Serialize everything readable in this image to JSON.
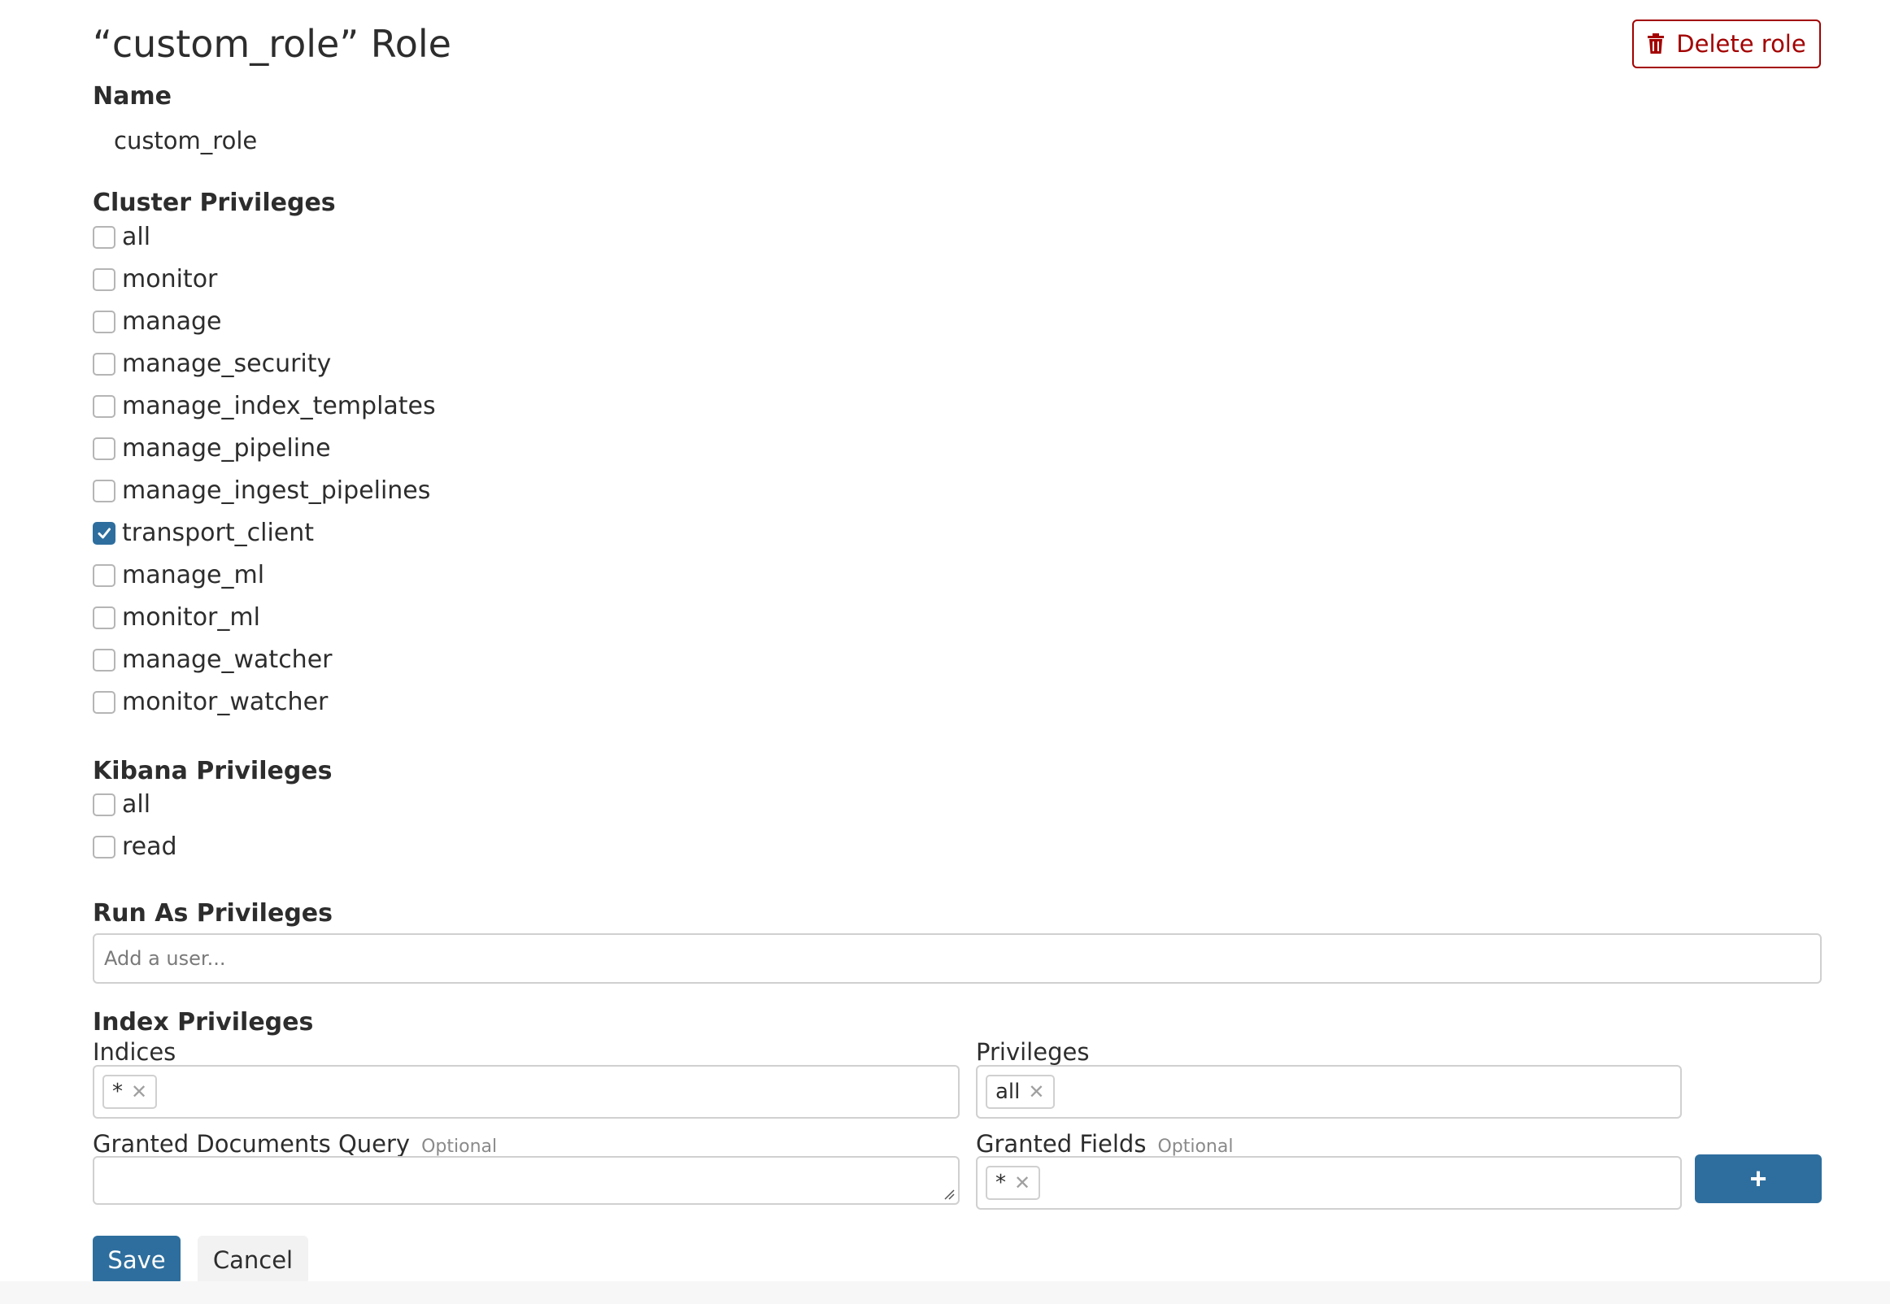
{
  "header": {
    "title": "“custom_role” Role",
    "delete_label": "Delete role"
  },
  "name_section": {
    "label": "Name",
    "value": "custom_role"
  },
  "cluster": {
    "label": "Cluster Privileges",
    "items": [
      {
        "label": "all",
        "checked": false
      },
      {
        "label": "monitor",
        "checked": false
      },
      {
        "label": "manage",
        "checked": false
      },
      {
        "label": "manage_security",
        "checked": false
      },
      {
        "label": "manage_index_templates",
        "checked": false
      },
      {
        "label": "manage_pipeline",
        "checked": false
      },
      {
        "label": "manage_ingest_pipelines",
        "checked": false
      },
      {
        "label": "transport_client",
        "checked": true
      },
      {
        "label": "manage_ml",
        "checked": false
      },
      {
        "label": "monitor_ml",
        "checked": false
      },
      {
        "label": "manage_watcher",
        "checked": false
      },
      {
        "label": "monitor_watcher",
        "checked": false
      }
    ]
  },
  "kibana": {
    "label": "Kibana Privileges",
    "items": [
      {
        "label": "all",
        "checked": false
      },
      {
        "label": "read",
        "checked": false
      }
    ]
  },
  "run_as": {
    "label": "Run As Privileges",
    "placeholder": "Add a user..."
  },
  "index": {
    "label": "Index Privileges",
    "indices_label": "Indices",
    "indices_tags": [
      "*"
    ],
    "privileges_label": "Privileges",
    "privileges_tags": [
      "all"
    ],
    "query_label": "Granted Documents Query",
    "query_optional": "Optional",
    "fields_label": "Granted Fields",
    "fields_optional": "Optional",
    "fields_tags": [
      "*"
    ],
    "add_label": "+"
  },
  "footer": {
    "save_label": "Save",
    "cancel_label": "Cancel"
  },
  "colors": {
    "primary": "#2e6e9e",
    "danger": "#a30000"
  },
  "icons": {
    "delete": "trash-icon",
    "checkmark": "checkmark-icon",
    "remove_tag": "close-icon"
  }
}
